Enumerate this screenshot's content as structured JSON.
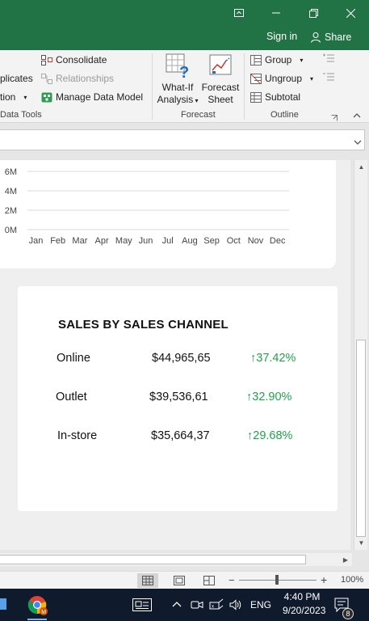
{
  "window": {
    "account_label": "Sign in",
    "share_label": "Share",
    "accent_color": "#217346"
  },
  "ribbon": {
    "data_tools": {
      "remove_duplicates_partial": "plicates",
      "data_validation_partial": "tion",
      "consolidate": "Consolidate",
      "relationships": "Relationships",
      "manage_data_model": "Manage Data Model",
      "group_label": "Data Tools"
    },
    "forecast": {
      "what_if_line1": "What-If",
      "what_if_line2": "Analysis",
      "forecast_sheet_line1": "Forecast",
      "forecast_sheet_line2": "Sheet",
      "group_label": "Forecast"
    },
    "outline": {
      "group": "Group",
      "ungroup": "Ungroup",
      "subtotal": "Subtotal",
      "group_label": "Outline"
    }
  },
  "chart_data": {
    "type": "line",
    "title": "",
    "xlabel": "",
    "ylabel": "",
    "categories": [
      "Jan",
      "Feb",
      "Mar",
      "Apr",
      "May",
      "Jun",
      "Jul",
      "Aug",
      "Sep",
      "Oct",
      "Nov",
      "Dec"
    ],
    "y_ticks": [
      "6M",
      "4M",
      "2M",
      "0M"
    ],
    "ylim": [
      0,
      6000000
    ],
    "grid": true,
    "series": []
  },
  "sales": {
    "title": "SALES BY SALES CHANNEL",
    "rows": [
      {
        "channel": "Online",
        "amount": "$44,965,65",
        "change": "↑37.42%"
      },
      {
        "channel": "Outlet",
        "amount": "$39,536,61",
        "change": "↑32.90%"
      },
      {
        "channel": "In-store",
        "amount": "$35,664,37",
        "change": "↑29.68%"
      }
    ],
    "positive_color": "#1fa34a"
  },
  "status": {
    "zoom": "100%"
  },
  "taskbar": {
    "language": "ENG",
    "time": "4:40 PM",
    "date": "9/20/2023",
    "notification_count": "8"
  }
}
